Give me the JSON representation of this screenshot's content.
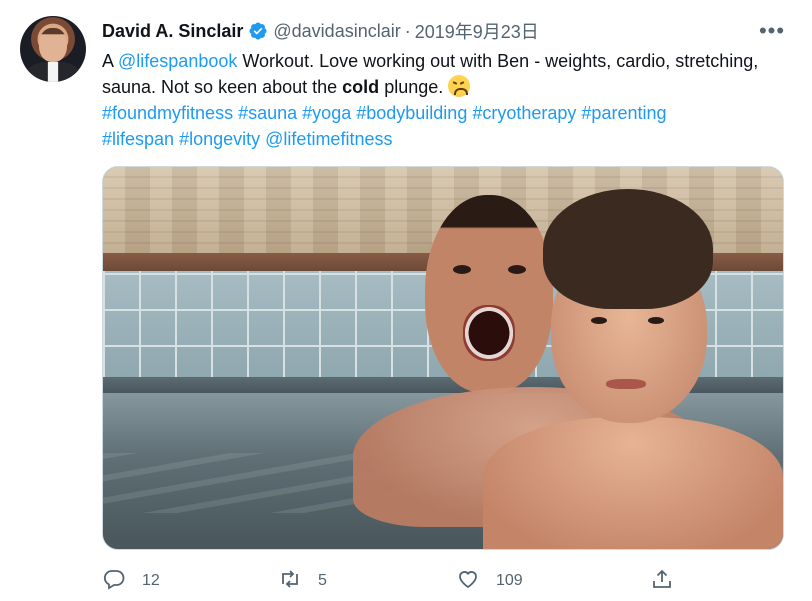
{
  "author": {
    "name": "David A. Sinclair",
    "handle": "@davidasinclair",
    "separator": "·",
    "date": "2019年9月23日"
  },
  "icons": {
    "verified": "verified-badge-icon",
    "more": "more-options-icon",
    "reply": "reply-icon",
    "retweet": "retweet-icon",
    "like": "heart-icon",
    "share": "share-icon",
    "emoji": "tired-face-emoji"
  },
  "colors": {
    "link": "#1d9bf0",
    "verified": "#1d9bf0",
    "secondary_text": "#536471"
  },
  "tweet": {
    "line1_prefix": "A ",
    "mention_book": "@lifespanbook",
    "line1_rest": " Workout. Love working out with Ben - weights, cardio, stretching, sauna. Not so keen about the ",
    "bold_word": "cold",
    "after_bold": " plunge. ",
    "hashtags_line1": [
      "#foundmyfitness",
      "#sauna",
      "#yoga",
      "#bodybuilding",
      "#cryotherapy",
      "#parenting"
    ],
    "hashtags_line2": [
      "#lifespan",
      "#longevity"
    ],
    "mention_gym": "@lifetimefitness"
  },
  "stats": {
    "replies": "12",
    "retweets": "5",
    "likes": "109"
  },
  "more_label": "•••"
}
